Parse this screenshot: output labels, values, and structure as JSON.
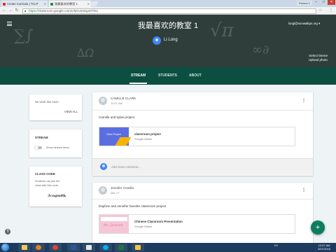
{
  "browser": {
    "tabs": [
      {
        "label": "Create Curricula | TCLP",
        "icon_color": "#d93025"
      },
      {
        "label": "我最喜欢的教室 1",
        "icon_color": "#1e8e3e"
      }
    ],
    "user_badge": "Person 1",
    "url_scheme": "https://",
    "url_rest": "classroom.google.com/c/MzUzNzg4OTE1",
    "window_controls": [
      "–",
      "□",
      "✕"
    ]
  },
  "header": {
    "menu_icon": "hamburger-icon",
    "class_title": "我最喜欢的教室 1",
    "teacher_name": "Li Long",
    "account_email": "longl@sonwalkps.org",
    "account_chevron": "▾",
    "select_theme": "Select theme",
    "upload_photo": "Upload photo"
  },
  "nav_tabs": [
    "STREAM",
    "STUDENTS",
    "ABOUT"
  ],
  "sidebar": {
    "upcoming": {
      "text": "No work due soon",
      "link": "VIEW ALL"
    },
    "stream": {
      "heading": "STREAM",
      "toggle_label": "Show deleted items"
    },
    "class_code": {
      "heading": "CLASS CODE",
      "description": "Students can join the class with this code:",
      "code": "3cogm8b",
      "chevron": "▾"
    }
  },
  "posts": [
    {
      "author": "CAMILLE CLARK",
      "date": "12:07 AM",
      "text": "Camille and kylas project",
      "attachment": {
        "title": "classroom project",
        "type": "Google Slides",
        "thumb_color": "#5b6ee1",
        "thumb_text": "Class Project"
      },
      "comment_placeholder": "Add class comment..."
    },
    {
      "author": "Jennifer Crosilla",
      "date": "Mar 17",
      "text": "Daphne and Jennifer favorite classroom project",
      "attachment": {
        "title": "Chinese Classroom Presentation",
        "type": "Google Slides",
        "thumb_color": "#f6c6d6",
        "thumb_text": "Ms. Jackson"
      }
    }
  ],
  "fab_label": "+",
  "help_label": "?",
  "taskbar": {
    "tray_text": "EN",
    "time": "10:37 AM",
    "date": "3/21/2016"
  },
  "colors": {
    "banner": "#2f3e3a",
    "nav": "#0c4f41",
    "accent": "#0d7d5f",
    "background": "#eef3f6"
  }
}
